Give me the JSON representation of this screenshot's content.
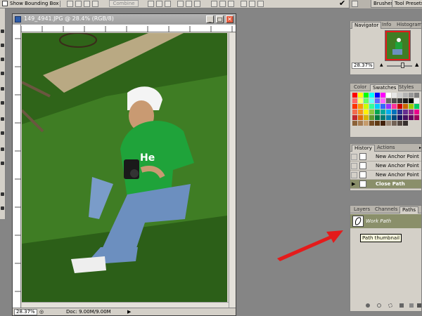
{
  "options_bar": {
    "show_bounding_box": "Show Bounding Box",
    "combine_label": "Combine",
    "commit_icon": "checkmark-icon"
  },
  "palette_well": {
    "tabs": [
      "Brushes",
      "Tool Presets"
    ]
  },
  "document": {
    "title": "149_4941.JPG @ 28.4% (RGB/8)",
    "status_zoom": "28.37%",
    "status_doc": "Doc: 9.00M/9.00M"
  },
  "navigator": {
    "tabs": [
      "Navigator",
      "Info",
      "Histogram"
    ],
    "zoom": "28.37%"
  },
  "swatches": {
    "tabs": [
      "Color",
      "Swatches",
      "Styles"
    ],
    "colors": [
      "#ff0000",
      "#ffff00",
      "#00ff00",
      "#00ffff",
      "#0000ff",
      "#ff00ff",
      "#ffffff",
      "#e6e6e6",
      "#cccccc",
      "#b3b3b3",
      "#999999",
      "#808080",
      "#ff6666",
      "#ffff66",
      "#66ff66",
      "#66ffff",
      "#6666ff",
      "#ff66ff",
      "#666666",
      "#4d4d4d",
      "#333333",
      "#1a1a1a",
      "#000000",
      "#f2f2f2",
      "#ff3300",
      "#ff9900",
      "#ccff00",
      "#33ff99",
      "#00ccff",
      "#3366ff",
      "#9933ff",
      "#ff3399",
      "#cc0000",
      "#cc6600",
      "#99cc00",
      "#00cc66",
      "#f26c4f",
      "#f7941d",
      "#fff200",
      "#8dc63f",
      "#00a651",
      "#00a99d",
      "#00aeef",
      "#0072bc",
      "#2e3192",
      "#662d91",
      "#92278f",
      "#ec008c",
      "#c1272d",
      "#e36c0a",
      "#d7b600",
      "#5e9c2f",
      "#00793f",
      "#007a72",
      "#0083b3",
      "#004a80",
      "#1b1464",
      "#440e62",
      "#630460",
      "#9e005d",
      "#8c6239",
      "#a67c52",
      "#c69c6d",
      "#754c24",
      "#603913",
      "#42210b",
      "#998675",
      "#736357",
      "#534741",
      "#362f2d"
    ]
  },
  "history": {
    "tabs": [
      "History",
      "Actions"
    ],
    "rows": [
      "New Anchor Point",
      "New Anchor Point",
      "New Anchor Point",
      "Close Path"
    ]
  },
  "paths": {
    "tabs": [
      "Layers",
      "Channels",
      "Paths"
    ],
    "row_label": "Work Path",
    "tooltip": "Path thumbnail"
  },
  "colors": {
    "selection": "#8a8f6a",
    "annotation_arrow": "#e41b1b"
  }
}
